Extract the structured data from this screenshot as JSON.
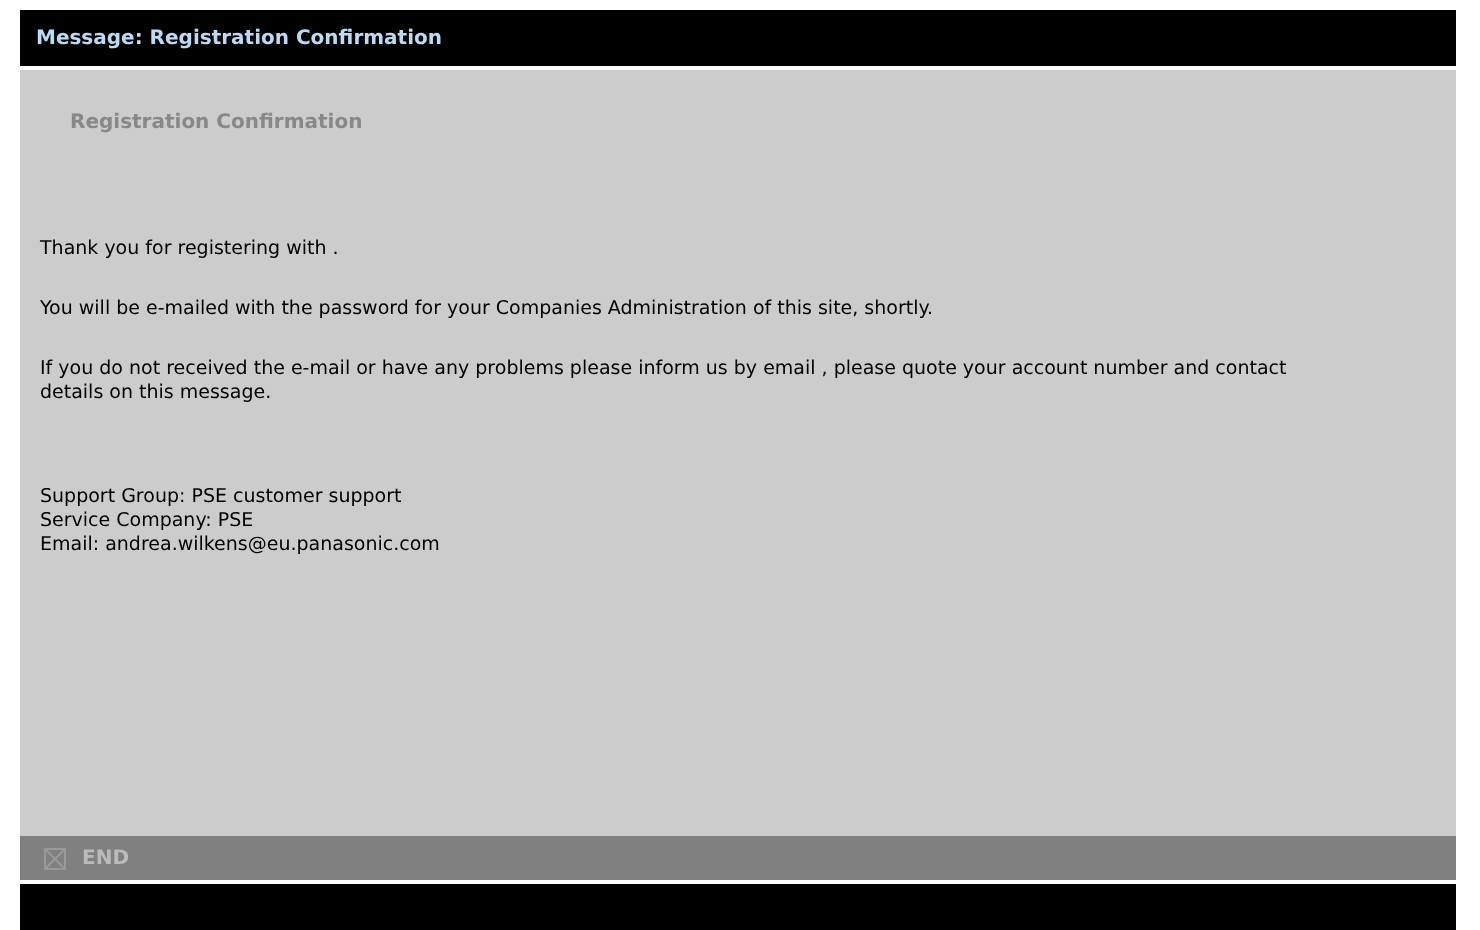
{
  "window": {
    "title": "Message: Registration Confirmation"
  },
  "heading": "Registration Confirmation",
  "paragraphs": [
    "Thank you for registering with .",
    "You will be e-mailed with the password for your Companies Administration of this site, shortly.",
    "If you do not received the e-mail or have any problems please inform us by  email  , please quote your account number and contact details on this message."
  ],
  "contact_lines": [
    "Support Group: PSE customer support",
    "Service Company: PSE",
    "Email: andrea.wilkens@eu.panasonic.com"
  ],
  "footer": {
    "button": "END"
  }
}
